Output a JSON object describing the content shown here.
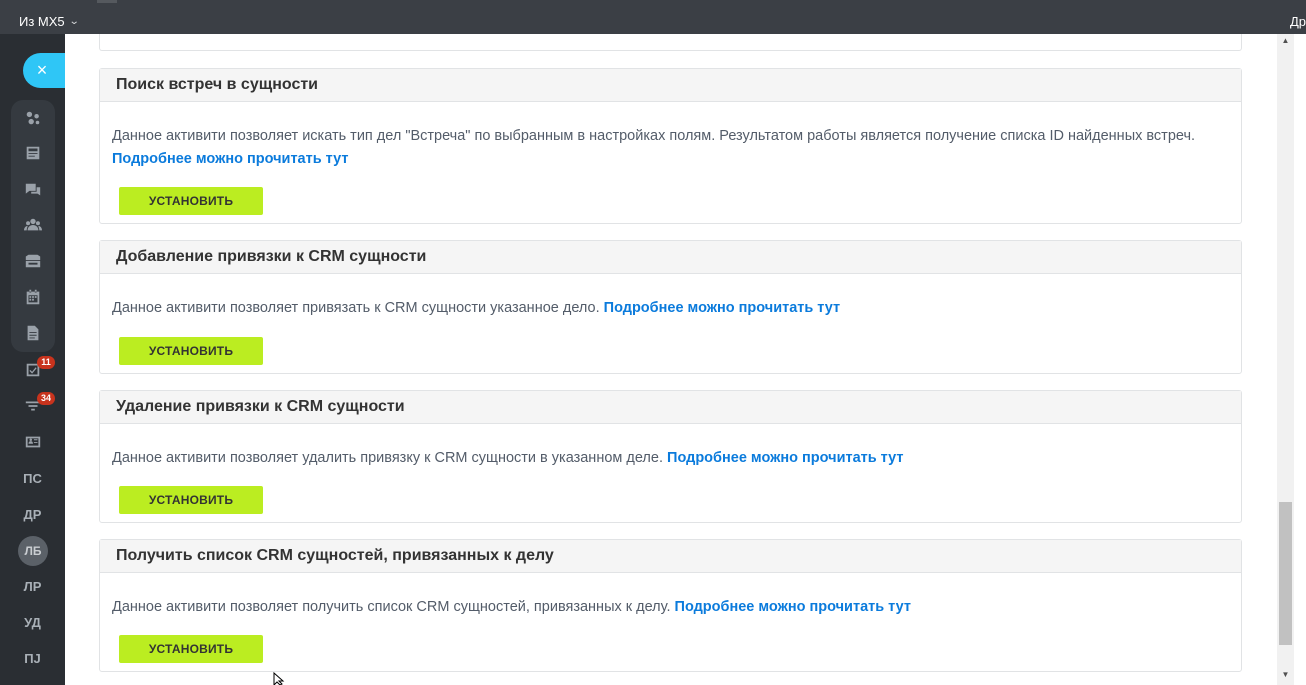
{
  "topbar": {
    "portal_name": "Из MX5",
    "portal_chevron": "chevron-down-icon",
    "right_cut_text": "Др"
  },
  "sidebar": {
    "close_icon": "×",
    "icons": [
      "sites-icon",
      "feed-icon",
      "chat-icon",
      "employees-icon",
      "crm-icon",
      "calendar-icon",
      "documents-icon",
      "tasks-icon",
      "filter-icon",
      "contacts-icon"
    ],
    "tasks_badge": "11",
    "filter_badge": "34",
    "text_items": [
      "ПС",
      "ДР",
      "ЛР",
      "УД",
      "ПЈ"
    ],
    "avatar_initials": "ЛБ"
  },
  "cards": [
    {
      "title": "Поиск встреч в сущности",
      "description": "Данное активити позволяет искать тип дел \"Встреча\" по выбранным в настройках полям. Результатом работы является получение списка ID найденных встреч.",
      "link": "Подробнее можно прочитать тут",
      "button": "УСТАНОВИТЬ"
    },
    {
      "title": "Добавление привязки к CRM сущности",
      "description": "Данное активити позволяет привязать к CRM сущности указанное дело.",
      "link": "Подробнее можно прочитать тут",
      "button": "УСТАНОВИТЬ"
    },
    {
      "title": "Удаление привязки к CRM сущности",
      "description": "Данное активити позволяет удалить привязку к CRM сущности в указанном деле.",
      "link": "Подробнее можно прочитать тут",
      "button": "УСТАНОВИТЬ"
    },
    {
      "title": "Получить список CRM сущностей, привязанных к делу",
      "description": "Данное активити позволяет получить список CRM сущностей, привязанных к делу.",
      "link": "Подробнее можно прочитать тут",
      "button": "УСТАНОВИТЬ"
    }
  ],
  "scrollbar": {
    "position_fraction": 0.95
  }
}
